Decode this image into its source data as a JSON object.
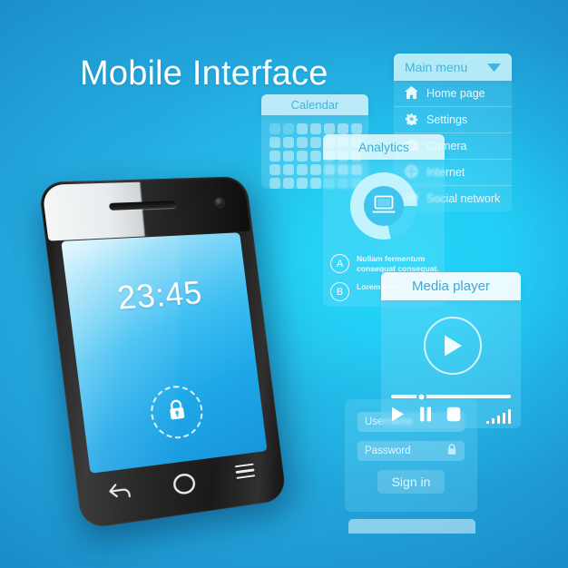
{
  "page": {
    "title": "Mobile Interface",
    "background_colors": {
      "deep_blue": "#1b8ec9",
      "bright_cyan": "#22d3f8",
      "edge_blue": "#1478b8"
    }
  },
  "phone": {
    "lock_screen": {
      "clock": "23:45",
      "lock_icon": "padlock-icon"
    },
    "nav_buttons": [
      {
        "name": "back",
        "icon": "back-arrow-icon"
      },
      {
        "name": "home",
        "icon": "home-circle-icon"
      },
      {
        "name": "menu",
        "icon": "hamburger-menu-icon"
      }
    ],
    "hardware": {
      "speaker": "speaker-grille",
      "camera": "front-camera"
    }
  },
  "panels": {
    "calendar": {
      "title": "Calendar",
      "grid": {
        "columns": 7,
        "rows": 5
      }
    },
    "main_menu": {
      "title": "Main menu",
      "dropdown_icon": "chevron-down-icon",
      "items": [
        {
          "label": "Home page",
          "icon": "home-icon"
        },
        {
          "label": "Settings",
          "icon": "gear-icon"
        },
        {
          "label": "Camera",
          "icon": "camera-icon"
        },
        {
          "label": "Internet",
          "icon": "globe-icon"
        },
        {
          "label": "Social network",
          "icon": "chat-bubble-icon"
        }
      ]
    },
    "analytics": {
      "title": "Analytics",
      "center_icon": "laptop-icon",
      "legend": [
        {
          "marker": "A",
          "text": "Nullam fermentum consequat consequat."
        },
        {
          "marker": "B",
          "text": "Lorem amet"
        }
      ]
    },
    "media_player": {
      "title": "Media player",
      "play_button_icon": "play-circle-icon",
      "progress_percent": 25,
      "controls": [
        {
          "name": "play",
          "icon": "play-icon"
        },
        {
          "name": "pause",
          "icon": "pause-icon"
        },
        {
          "name": "stop",
          "icon": "stop-icon"
        }
      ],
      "volume_bars": 5
    },
    "login": {
      "username_placeholder": "Username",
      "password_placeholder": "Password",
      "password_icon": "lock-icon",
      "sign_in_label": "Sign in"
    }
  },
  "chart_data": {
    "type": "pie",
    "title": "Analytics",
    "categories": [
      "A",
      "B"
    ],
    "values": [
      78,
      22
    ],
    "labels": [
      "Nullam fermentum consequat consequat.",
      "Lorem amet"
    ],
    "colors": [
      "#cdf5fd",
      "#45d8f7"
    ],
    "donut": true,
    "legend_position": "bottom"
  }
}
